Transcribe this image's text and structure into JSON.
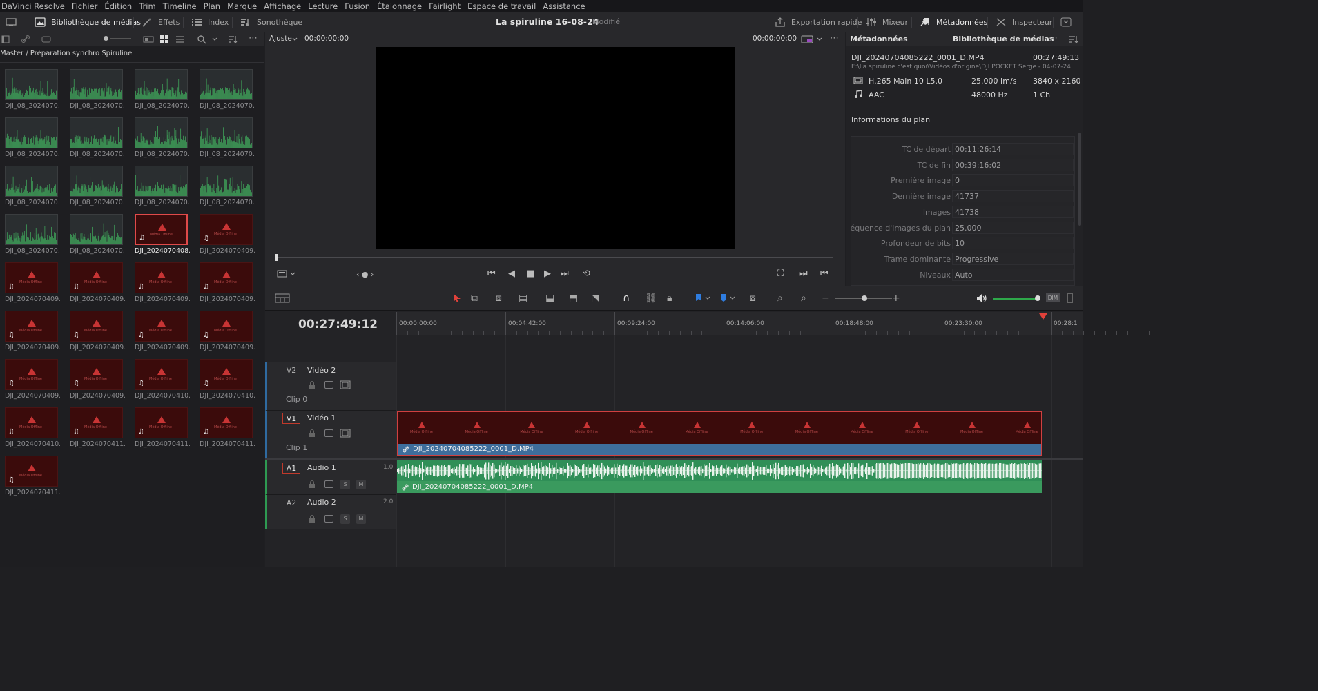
{
  "menu": [
    "DaVinci Resolve",
    "Fichier",
    "Édition",
    "Trim",
    "Timeline",
    "Plan",
    "Marque",
    "Affichage",
    "Lecture",
    "Fusion",
    "Étalonnage",
    "Fairlight",
    "Espace de travail",
    "Assistance"
  ],
  "toolbar": {
    "media_pool": "Bibliothèque de médias",
    "effects": "Effets",
    "index": "Index",
    "sound_library": "Sonothèque",
    "quick_export": "Exportation rapide",
    "mixer": "Mixeur",
    "metadata": "Métadonnées",
    "inspector": "Inspecteur"
  },
  "project": {
    "title": "La spiruline 16-08-24",
    "status": "Modifié"
  },
  "pool": {
    "breadcrumb": "Master / Préparation synchro Spiruline",
    "clips": [
      {
        "label": "DJI_08_2024070...",
        "type": "video"
      },
      {
        "label": "DJI_08_2024070...",
        "type": "video"
      },
      {
        "label": "DJI_08_2024070...",
        "type": "video"
      },
      {
        "label": "DJI_08_2024070...",
        "type": "video"
      },
      {
        "label": "DJI_08_2024070...",
        "type": "video"
      },
      {
        "label": "DJI_08_2024070...",
        "type": "video"
      },
      {
        "label": "DJI_08_2024070...",
        "type": "video"
      },
      {
        "label": "DJI_08_2024070...",
        "type": "video"
      },
      {
        "label": "DJI_08_2024070...",
        "type": "video"
      },
      {
        "label": "DJI_08_2024070...",
        "type": "video"
      },
      {
        "label": "DJI_08_2024070...",
        "type": "video"
      },
      {
        "label": "DJI_08_2024070...",
        "type": "video"
      },
      {
        "label": "DJI_08_2024070...",
        "type": "video"
      },
      {
        "label": "DJI_08_2024070...",
        "type": "video"
      },
      {
        "label": "DJI_2024070408...",
        "type": "offline",
        "selected": true
      },
      {
        "label": "DJI_2024070409...",
        "type": "offline"
      },
      {
        "label": "DJI_2024070409...",
        "type": "offline"
      },
      {
        "label": "DJI_2024070409...",
        "type": "offline"
      },
      {
        "label": "DJI_2024070409...",
        "type": "offline"
      },
      {
        "label": "DJI_2024070409...",
        "type": "offline"
      },
      {
        "label": "DJI_2024070409...",
        "type": "offline"
      },
      {
        "label": "DJI_2024070409...",
        "type": "offline"
      },
      {
        "label": "DJI_2024070409...",
        "type": "offline"
      },
      {
        "label": "DJI_2024070409...",
        "type": "offline"
      },
      {
        "label": "DJI_2024070409...",
        "type": "offline"
      },
      {
        "label": "DJI_2024070409...",
        "type": "offline"
      },
      {
        "label": "DJI_2024070410...",
        "type": "offline"
      },
      {
        "label": "DJI_2024070410...",
        "type": "offline"
      },
      {
        "label": "DJI_2024070410...",
        "type": "offline"
      },
      {
        "label": "DJI_2024070411...",
        "type": "offline"
      },
      {
        "label": "DJI_2024070411...",
        "type": "offline"
      },
      {
        "label": "DJI_2024070411...",
        "type": "offline"
      },
      {
        "label": "DJI_2024070411...",
        "type": "offline"
      }
    ],
    "offline_text": "Média Offline"
  },
  "viewer": {
    "zoom": "Ajuste",
    "tc_left": "00:00:00:00",
    "tc_right": "00:00:00:00"
  },
  "metadata": {
    "tab1": "Métadonnées",
    "tab2": "Bibliothèque de médias",
    "filename": "DJI_20240704085222_0001_D.MP4",
    "duration": "00:27:49:13",
    "path": "E:\\La spiruline c'est quoi\\Vidéos d'origine\\DJI POCKET Serge - 04-07-24",
    "codec": "H.265 Main 10 L5.0",
    "fps": "25.000 Im/s",
    "resolution": "3840 x 2160",
    "audio_codec": "AAC",
    "audio_rate": "48000 Hz",
    "audio_ch": "1 Ch",
    "section": "Informations du plan",
    "rows": [
      {
        "label": "TC de départ",
        "value": "00:11:26:14"
      },
      {
        "label": "TC de fin",
        "value": "00:39:16:02"
      },
      {
        "label": "Première image",
        "value": "0"
      },
      {
        "label": "Dernière image",
        "value": "41737"
      },
      {
        "label": "Images",
        "value": "41738"
      },
      {
        "label": "équence d'images du plan",
        "value": "25.000"
      },
      {
        "label": "Profondeur de bits",
        "value": "10"
      },
      {
        "label": "Trame dominante",
        "value": "Progressive"
      },
      {
        "label": "Niveaux",
        "value": "Auto"
      }
    ]
  },
  "timeline": {
    "timecode": "00:27:49:12",
    "ruler": [
      "00:00:00:00",
      "00:04:42:00",
      "00:09:24:00",
      "00:14:06:00",
      "00:18:48:00",
      "00:23:30:00",
      "00:28:1"
    ],
    "tracks": {
      "v2": {
        "id": "V2",
        "name": "Vidéo 2",
        "sub": "Clip 0"
      },
      "v1": {
        "id": "V1",
        "name": "Vidéo 1",
        "sub": "Clip 1"
      },
      "a1": {
        "id": "A1",
        "name": "Audio 1",
        "level": "1.0"
      },
      "a2": {
        "id": "A2",
        "name": "Audio 2",
        "level": "2.0"
      }
    },
    "video_clip": "DJI_20240704085222_0001_D.MP4",
    "audio_clip": "DJI_20240704085222_0001_D.MP4",
    "solo": "S",
    "mute": "M",
    "dim": "DIM"
  },
  "colors": {
    "accent": "#e0413a",
    "video_clip": "#3e6e9c",
    "audio_clip": "#3a9a5e",
    "offline": "#3b0b0b"
  }
}
